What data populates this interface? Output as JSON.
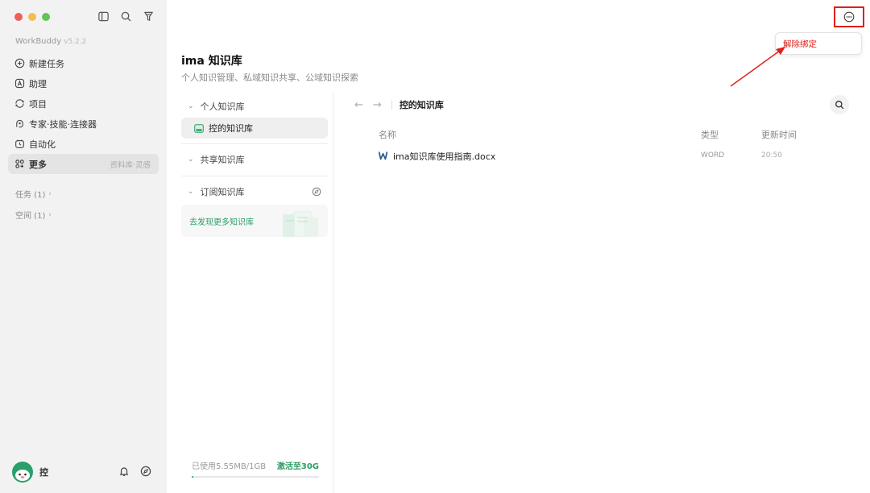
{
  "app": {
    "name": "WorkBuddy",
    "version": "v5.2.2"
  },
  "sidebar": {
    "items": [
      {
        "label": "新建任务",
        "icon": "plus-circle-icon"
      },
      {
        "label": "助理",
        "icon": "assistant-icon"
      },
      {
        "label": "项目",
        "icon": "project-icon"
      },
      {
        "label": "专家·技能·连接器",
        "icon": "expert-icon"
      },
      {
        "label": "自动化",
        "icon": "automation-icon"
      },
      {
        "label": "更多",
        "icon": "more-grid-icon",
        "sub": "资料库·灵感",
        "active": true
      }
    ],
    "sections": [
      {
        "label": "任务 (1)"
      },
      {
        "label": "空间 (1)"
      }
    ],
    "user": {
      "name": "控"
    }
  },
  "header": {
    "menu": {
      "unbind_label": "解除绑定"
    },
    "accent_color": "#e0201b"
  },
  "page": {
    "title": "ima 知识库",
    "subtitle": "个人知识管理、私域知识共享、公域知识探索"
  },
  "kb": {
    "groups": [
      {
        "label": "个人知识库",
        "items": [
          {
            "label": "控的知识库",
            "active": true
          }
        ]
      },
      {
        "label": "共享知识库"
      },
      {
        "label": "订阅知识库"
      }
    ],
    "discover_label": "去发现更多知识库",
    "storage": {
      "used": "已使用5.55MB/1GB",
      "upgrade": "激活至30G",
      "fraction": 0.0054
    }
  },
  "files": {
    "breadcrumb": "控的知识库",
    "columns": {
      "name": "名称",
      "type": "类型",
      "updated": "更新时间"
    },
    "rows": [
      {
        "name": "ima知识库使用指南.docx",
        "type": "WORD",
        "updated": "20:50",
        "icon": "word-doc-icon"
      }
    ]
  },
  "colors": {
    "brand_green": "#2a9e64",
    "sidebar_bg": "#f2f2f2"
  }
}
